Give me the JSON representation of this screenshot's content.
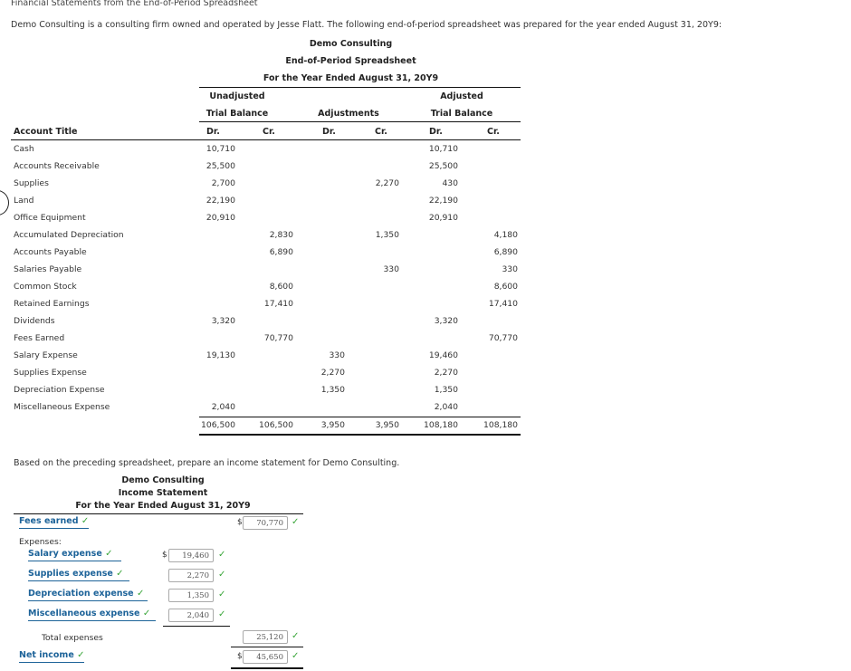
{
  "page_title": "Financial Statements from the End-of-Period Spreadsheet",
  "intro": "Demo Consulting is a consulting firm owned and operated by Jesse Flatt. The following end-of-period spreadsheet was prepared for the year ended August 31, 20Y9:",
  "worksheet": {
    "company": "Demo Consulting",
    "title": "End-of-Period Spreadsheet",
    "period": "For the Year Ended August 31, 20Y9",
    "groups": {
      "unadjusted_line1": "Unadjusted",
      "unadjusted_line2": "Trial Balance",
      "adjustments": "Adjustments",
      "adjusted_line1": "Adjusted",
      "adjusted_line2": "Trial Balance"
    },
    "account_title_header": "Account Title",
    "dr": "Dr.",
    "cr": "Cr.",
    "rows": [
      {
        "account": "Cash",
        "utb_dr": "10,710",
        "utb_cr": "",
        "adj_dr": "",
        "adj_cr": "",
        "atb_dr": "10,710",
        "atb_cr": ""
      },
      {
        "account": "Accounts Receivable",
        "utb_dr": "25,500",
        "utb_cr": "",
        "adj_dr": "",
        "adj_cr": "",
        "atb_dr": "25,500",
        "atb_cr": ""
      },
      {
        "account": "Supplies",
        "utb_dr": "2,700",
        "utb_cr": "",
        "adj_dr": "",
        "adj_cr": "2,270",
        "atb_dr": "430",
        "atb_cr": ""
      },
      {
        "account": "Land",
        "utb_dr": "22,190",
        "utb_cr": "",
        "adj_dr": "",
        "adj_cr": "",
        "atb_dr": "22,190",
        "atb_cr": ""
      },
      {
        "account": "Office Equipment",
        "utb_dr": "20,910",
        "utb_cr": "",
        "adj_dr": "",
        "adj_cr": "",
        "atb_dr": "20,910",
        "atb_cr": ""
      },
      {
        "account": "Accumulated Depreciation",
        "utb_dr": "",
        "utb_cr": "2,830",
        "adj_dr": "",
        "adj_cr": "1,350",
        "atb_dr": "",
        "atb_cr": "4,180"
      },
      {
        "account": "Accounts Payable",
        "utb_dr": "",
        "utb_cr": "6,890",
        "adj_dr": "",
        "adj_cr": "",
        "atb_dr": "",
        "atb_cr": "6,890"
      },
      {
        "account": "Salaries Payable",
        "utb_dr": "",
        "utb_cr": "",
        "adj_dr": "",
        "adj_cr": "330",
        "atb_dr": "",
        "atb_cr": "330"
      },
      {
        "account": "Common Stock",
        "utb_dr": "",
        "utb_cr": "8,600",
        "adj_dr": "",
        "adj_cr": "",
        "atb_dr": "",
        "atb_cr": "8,600"
      },
      {
        "account": "Retained Earnings",
        "utb_dr": "",
        "utb_cr": "17,410",
        "adj_dr": "",
        "adj_cr": "",
        "atb_dr": "",
        "atb_cr": "17,410"
      },
      {
        "account": "Dividends",
        "utb_dr": "3,320",
        "utb_cr": "",
        "adj_dr": "",
        "adj_cr": "",
        "atb_dr": "3,320",
        "atb_cr": ""
      },
      {
        "account": "Fees Earned",
        "utb_dr": "",
        "utb_cr": "70,770",
        "adj_dr": "",
        "adj_cr": "",
        "atb_dr": "",
        "atb_cr": "70,770"
      },
      {
        "account": "Salary Expense",
        "utb_dr": "19,130",
        "utb_cr": "",
        "adj_dr": "330",
        "adj_cr": "",
        "atb_dr": "19,460",
        "atb_cr": ""
      },
      {
        "account": "Supplies Expense",
        "utb_dr": "",
        "utb_cr": "",
        "adj_dr": "2,270",
        "adj_cr": "",
        "atb_dr": "2,270",
        "atb_cr": ""
      },
      {
        "account": "Depreciation Expense",
        "utb_dr": "",
        "utb_cr": "",
        "adj_dr": "1,350",
        "adj_cr": "",
        "atb_dr": "1,350",
        "atb_cr": ""
      },
      {
        "account": "Miscellaneous Expense",
        "utb_dr": "2,040",
        "utb_cr": "",
        "adj_dr": "",
        "adj_cr": "",
        "atb_dr": "2,040",
        "atb_cr": ""
      }
    ],
    "totals": {
      "utb_dr": "106,500",
      "utb_cr": "106,500",
      "adj_dr": "3,950",
      "adj_cr": "3,950",
      "atb_dr": "108,180",
      "atb_cr": "108,180"
    }
  },
  "income_statement": {
    "instruction": "Based on the preceding spreadsheet, prepare an income statement for Demo Consulting.",
    "company": "Demo Consulting",
    "title": "Income Statement",
    "period": "For the Year Ended August 31, 20Y9",
    "revenue": {
      "label": "Fees earned",
      "value": "70,770",
      "currency": "$"
    },
    "expenses_label": "Expenses:",
    "expenses": [
      {
        "label": "Salary expense",
        "value": "19,460",
        "currency": "$"
      },
      {
        "label": "Supplies expense",
        "value": "2,270",
        "currency": ""
      },
      {
        "label": "Depreciation expense",
        "value": "1,350",
        "currency": ""
      },
      {
        "label": "Miscellaneous expense",
        "value": "2,040",
        "currency": ""
      }
    ],
    "total_expenses": {
      "label": "Total expenses",
      "value": "25,120"
    },
    "net_income": {
      "label": "Net income",
      "value": "45,650",
      "currency": "$"
    },
    "check_glyph": "✓",
    "status_color": "#3aa63a",
    "label_color": "#1d6399"
  }
}
